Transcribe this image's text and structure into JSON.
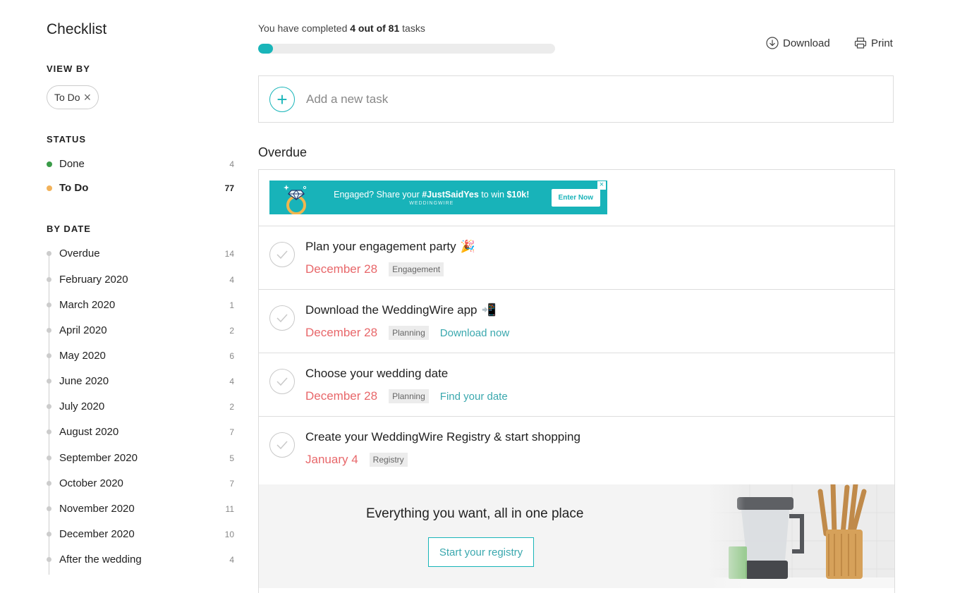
{
  "sidebar": {
    "title": "Checklist",
    "view_by_label": "VIEW BY",
    "view_chip": "To Do",
    "status_label": "STATUS",
    "status_items": [
      {
        "label": "Done",
        "count": "4",
        "color": "#3a9b48"
      },
      {
        "label": "To Do",
        "count": "77",
        "color": "#f2b25a"
      }
    ],
    "by_date_label": "BY DATE",
    "date_items": [
      {
        "label": "Overdue",
        "count": "14"
      },
      {
        "label": "February 2020",
        "count": "4"
      },
      {
        "label": "March 2020",
        "count": "1"
      },
      {
        "label": "April 2020",
        "count": "2"
      },
      {
        "label": "May 2020",
        "count": "6"
      },
      {
        "label": "June 2020",
        "count": "4"
      },
      {
        "label": "July 2020",
        "count": "2"
      },
      {
        "label": "August 2020",
        "count": "7"
      },
      {
        "label": "September 2020",
        "count": "5"
      },
      {
        "label": "October 2020",
        "count": "7"
      },
      {
        "label": "November 2020",
        "count": "11"
      },
      {
        "label": "December 2020",
        "count": "10"
      },
      {
        "label": "After the wedding",
        "count": "4"
      }
    ]
  },
  "progress": {
    "prefix": "You have completed ",
    "completed": "4 out of 81",
    "suffix": " tasks",
    "fraction": 0.049
  },
  "actions": {
    "download_label": "Download",
    "print_label": "Print"
  },
  "add_task": {
    "placeholder": "Add a new task"
  },
  "overdue_heading": "Overdue",
  "ad": {
    "text_prefix": "Engaged? Share your ",
    "hashtag": "#JustSaidYes",
    "text_mid": " to win ",
    "prize": "$10k!",
    "brand": "WEDDINGWIRE",
    "button": "Enter Now",
    "close": "×"
  },
  "tasks": [
    {
      "title": "Plan your engagement party",
      "emoji": "🎉",
      "date": "December 28",
      "tag": "Engagement",
      "link": ""
    },
    {
      "title": "Download the WeddingWire app",
      "emoji": "📲",
      "date": "December 28",
      "tag": "Planning",
      "link": "Download now"
    },
    {
      "title": "Choose your wedding date",
      "emoji": "",
      "date": "December 28",
      "tag": "Planning",
      "link": "Find your date"
    },
    {
      "title": "Create your WeddingWire Registry & start shopping",
      "emoji": "",
      "date": "January 4",
      "tag": "Registry",
      "link": ""
    }
  ],
  "promo": {
    "title": "Everything you want, all in one place",
    "button": "Start your registry"
  },
  "colors": {
    "accent": "#19b5b9",
    "overdue_date": "#e8676a"
  }
}
